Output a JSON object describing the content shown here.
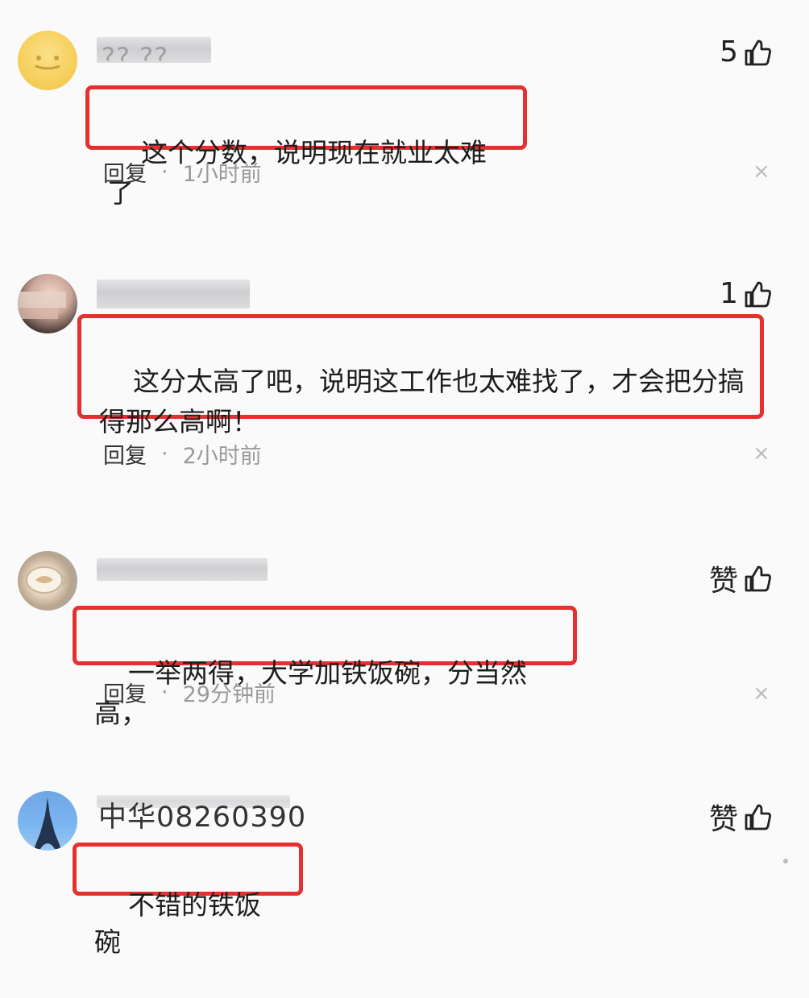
{
  "colors": {
    "highlight_border": "#e53030",
    "meta_gray": "#9a9a9a",
    "background": "#fafafb"
  },
  "comments": [
    {
      "avatar": "yellow-avatar",
      "name_visible": "?? ??",
      "like_label": "5",
      "text": "这个分数，说明现在就业太难了",
      "reply_label": "回复",
      "separator": "·",
      "time": "1小时前",
      "close_label": "×"
    },
    {
      "avatar": "portrait-avatar",
      "name_visible": "",
      "like_label": "1",
      "text": "这分太高了吧，说明这工作也太难找了，才会把分搞\n得那么高啊！",
      "reply_label": "回复",
      "separator": "·",
      "time": "2小时前",
      "close_label": "×"
    },
    {
      "avatar": "coffee-avatar",
      "name_visible": "",
      "like_label": "赞",
      "text": "一举两得，大学加铁饭碗，分当然高，",
      "reply_label": "回复",
      "separator": "·",
      "time": "29分钟前",
      "close_label": "×"
    },
    {
      "avatar": "eiffel-avatar",
      "name_visible": "中华08260390",
      "like_label": "赞",
      "text": "不错的铁饭碗",
      "reply_label": "",
      "separator": "",
      "time": "",
      "close_label": ""
    }
  ]
}
